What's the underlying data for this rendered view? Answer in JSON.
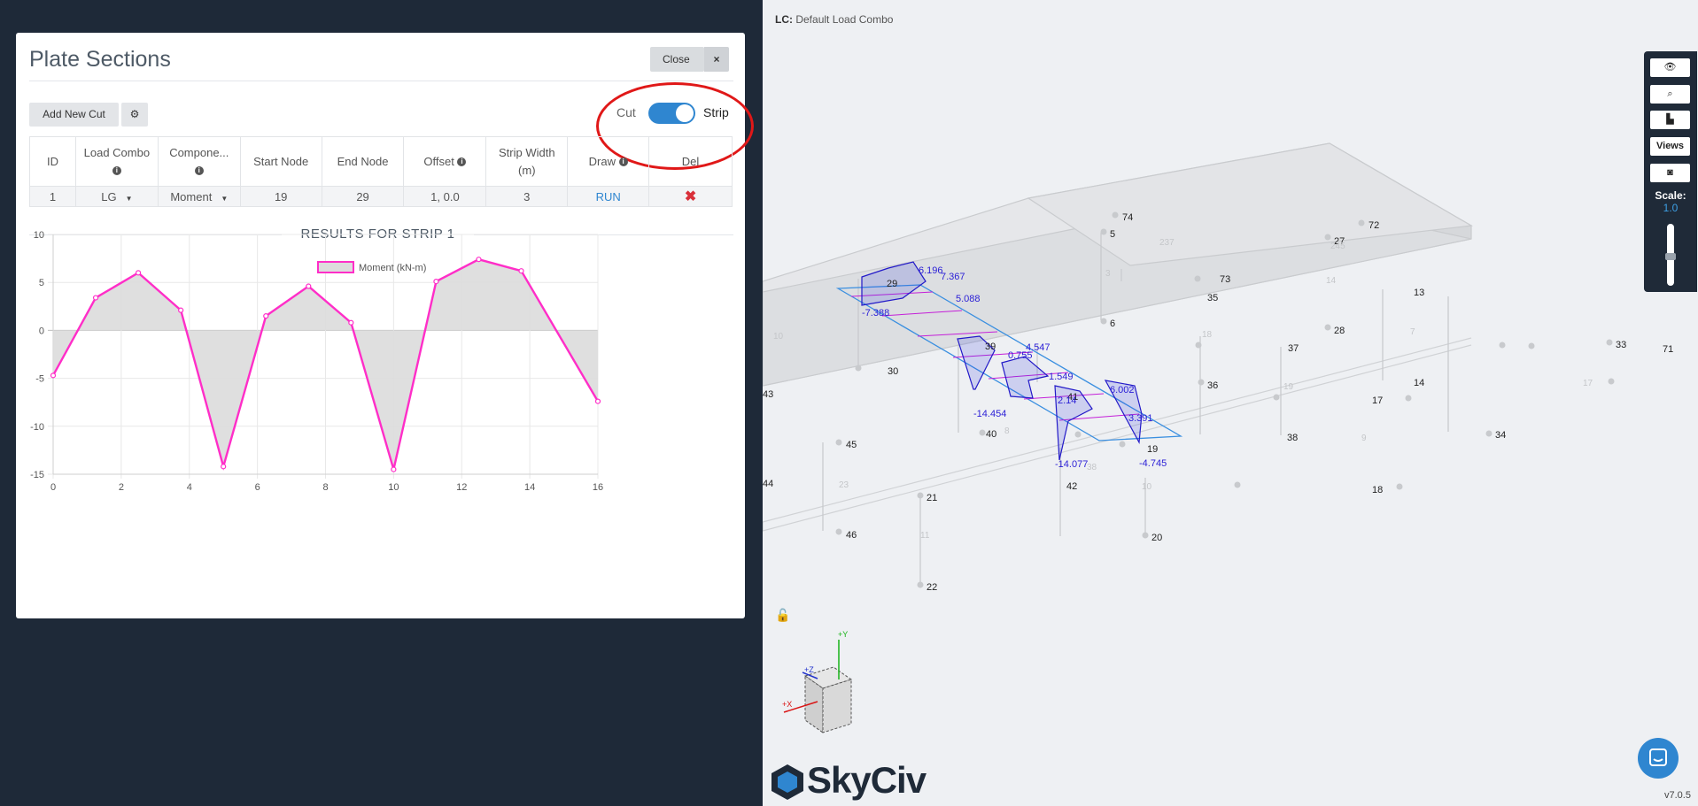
{
  "panel": {
    "title": "Plate Sections",
    "close_label": "Close",
    "close_icon": "×",
    "add_cut_label": "Add New Cut",
    "settings_icon": "⚙",
    "toggle": {
      "left_label": "Cut",
      "right_label": "Strip",
      "value": "Strip"
    }
  },
  "table": {
    "headers": [
      "ID",
      "Load Combo",
      "Compone...",
      "Start Node",
      "End Node",
      "Offset",
      "Strip Width (m)",
      "Draw",
      "Del"
    ],
    "rows": [
      {
        "id": "1",
        "load_combo": "LG",
        "component": "Moment",
        "start_node": "19",
        "end_node": "29",
        "offset": "1, 0.0",
        "strip_width": "3",
        "draw": "RUN",
        "del_icon": "✖"
      }
    ]
  },
  "results": {
    "title": "RESULTS FOR STRIP 1"
  },
  "chart_data": {
    "type": "line",
    "legend": "Moment (kN-m)",
    "x": [
      0,
      1.25,
      2.5,
      3.75,
      5,
      6.25,
      7.5,
      8.75,
      10,
      11.25,
      12.5,
      13.75,
      16
    ],
    "series": [
      {
        "name": "Moment (kN-m)",
        "values": [
          -4.7,
          3.4,
          6.0,
          2.1,
          -14.2,
          1.5,
          4.6,
          0.8,
          -14.5,
          5.1,
          7.4,
          6.2,
          -7.4
        ]
      }
    ],
    "xlim": [
      0,
      16
    ],
    "ylim": [
      -15,
      10
    ],
    "xticks": [
      0,
      2,
      4,
      6,
      8,
      10,
      12,
      14,
      16
    ],
    "yticks": [
      10,
      5,
      0,
      -5,
      -10,
      -15
    ],
    "colors": {
      "line": "#ff2ec8",
      "fill": "#dcdcdc"
    },
    "grid": true,
    "legend_position": "top-center"
  },
  "viewport": {
    "lc_prefix": "LC:",
    "lc_value": "Default Load Combo",
    "toolbar": {
      "views_label": "Views",
      "scale_label": "Scale:",
      "scale_value": "1.0"
    },
    "version": "v7.0.5",
    "logo_text": "SkyCiv",
    "node_labels": [
      "74",
      "5",
      "72",
      "27",
      "73",
      "35",
      "6",
      "13",
      "28",
      "37",
      "33",
      "71",
      "30",
      "36",
      "14",
      "43",
      "40",
      "38",
      "17",
      "34",
      "45",
      "42",
      "19",
      "18",
      "44",
      "21",
      "46",
      "20",
      "22",
      "29",
      "39",
      "41"
    ],
    "member_labels": [
      "10",
      "3",
      "237",
      "245",
      "14",
      "18",
      "7",
      "17",
      "19",
      "8",
      "9",
      "23",
      "11",
      "38",
      "10"
    ],
    "moment_labels": [
      "6.196",
      "7.367",
      "5.088",
      "-7.388",
      "4.547",
      "0.755",
      "1.549",
      "6.002",
      "2.14",
      "3.391",
      "-14.454",
      "-14.077",
      "-4.745"
    ],
    "axes": {
      "y": "+Y",
      "x": "+X",
      "z": "+Z"
    }
  }
}
